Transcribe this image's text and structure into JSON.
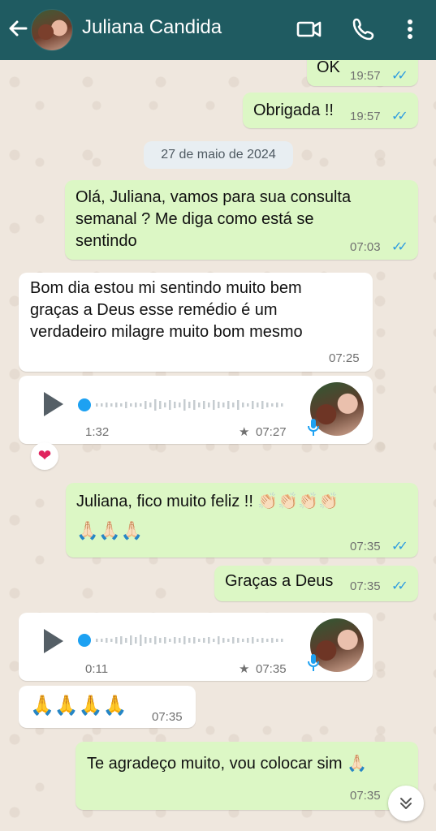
{
  "header": {
    "contact_name": "Juliana Candida",
    "back_icon": "arrow-left-icon",
    "icons": [
      "video-call-icon",
      "phone-icon",
      "more-vert-icon"
    ]
  },
  "date_separator": "27 de maio de 2024",
  "messages": [
    {
      "dir": "out",
      "text": "OK",
      "time": "19:57",
      "status": "read"
    },
    {
      "dir": "out",
      "text": "Obrigada !!",
      "time": "19:57",
      "status": "read"
    },
    {
      "dir": "out",
      "lines": [
        "Olá, Juliana, vamos para sua consulta",
        "semanal ? Me diga como está se",
        "sentindo"
      ],
      "time": "07:03",
      "status": "read"
    },
    {
      "dir": "in",
      "lines": [
        "Bom dia estou mi sentindo muito bem",
        "graças a Deus esse remédio é um",
        "verdadeiro milagre muito bom mesmo"
      ],
      "time": "07:25"
    },
    {
      "dir": "in",
      "type": "audio",
      "duration": "1:32",
      "time": "07:27",
      "starred": true,
      "reaction": "❤"
    },
    {
      "dir": "out",
      "lines": [
        "Juliana, fico muito feliz !! 👏🏻👏🏻👏🏻👏🏻",
        "🙏🏻🙏🏻🙏🏻"
      ],
      "time": "07:35",
      "status": "read"
    },
    {
      "dir": "out",
      "text": "Graças a Deus",
      "time": "07:35",
      "status": "read"
    },
    {
      "dir": "in",
      "type": "audio",
      "duration": "0:11",
      "time": "07:35",
      "starred": true
    },
    {
      "dir": "in",
      "text": "🙏🙏🙏🙏",
      "time": "07:35"
    },
    {
      "dir": "out",
      "text": "Te agradeço muito, vou colocar sim 🙏🏻",
      "time": "07:35",
      "status": "read"
    }
  ],
  "icons": {
    "read_receipt": "✓✓",
    "star": "★",
    "scroll_down": "⌄⌄"
  },
  "colors": {
    "header": "#1f5b61",
    "outgoing_bubble": "#dcf7c5",
    "incoming_bubble": "#ffffff",
    "read_tick": "#2d9be0",
    "audio_dot": "#1da1f2"
  }
}
